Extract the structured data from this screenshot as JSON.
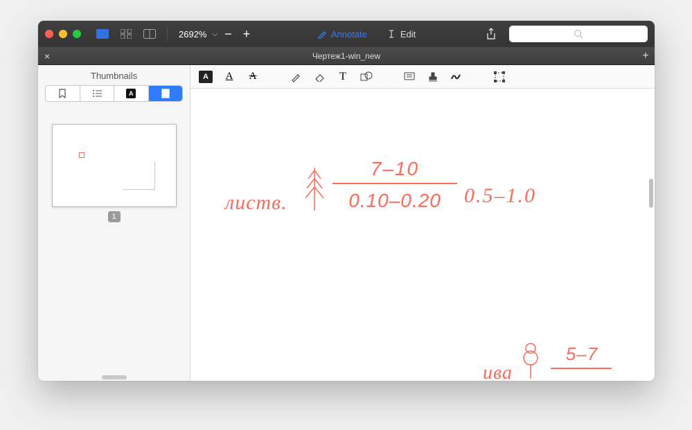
{
  "window": {
    "tab_title": "Чертеж1-win_new"
  },
  "toolbar": {
    "zoom_value": "2692%",
    "annotate_label": "Annotate",
    "edit_label": "Edit",
    "search_placeholder": ""
  },
  "sidebar": {
    "title": "Thumbnails",
    "thumb_number": "1"
  },
  "drawing": {
    "item1": {
      "label": "листв.",
      "numerator": "7–10",
      "denominator": "0.10–0.20",
      "value": "0.5–1.0"
    },
    "item2": {
      "label": "ива",
      "numerator": "5–7"
    }
  },
  "colors": {
    "accent": "#2f7cff",
    "annotation": "#ff6a5a"
  }
}
